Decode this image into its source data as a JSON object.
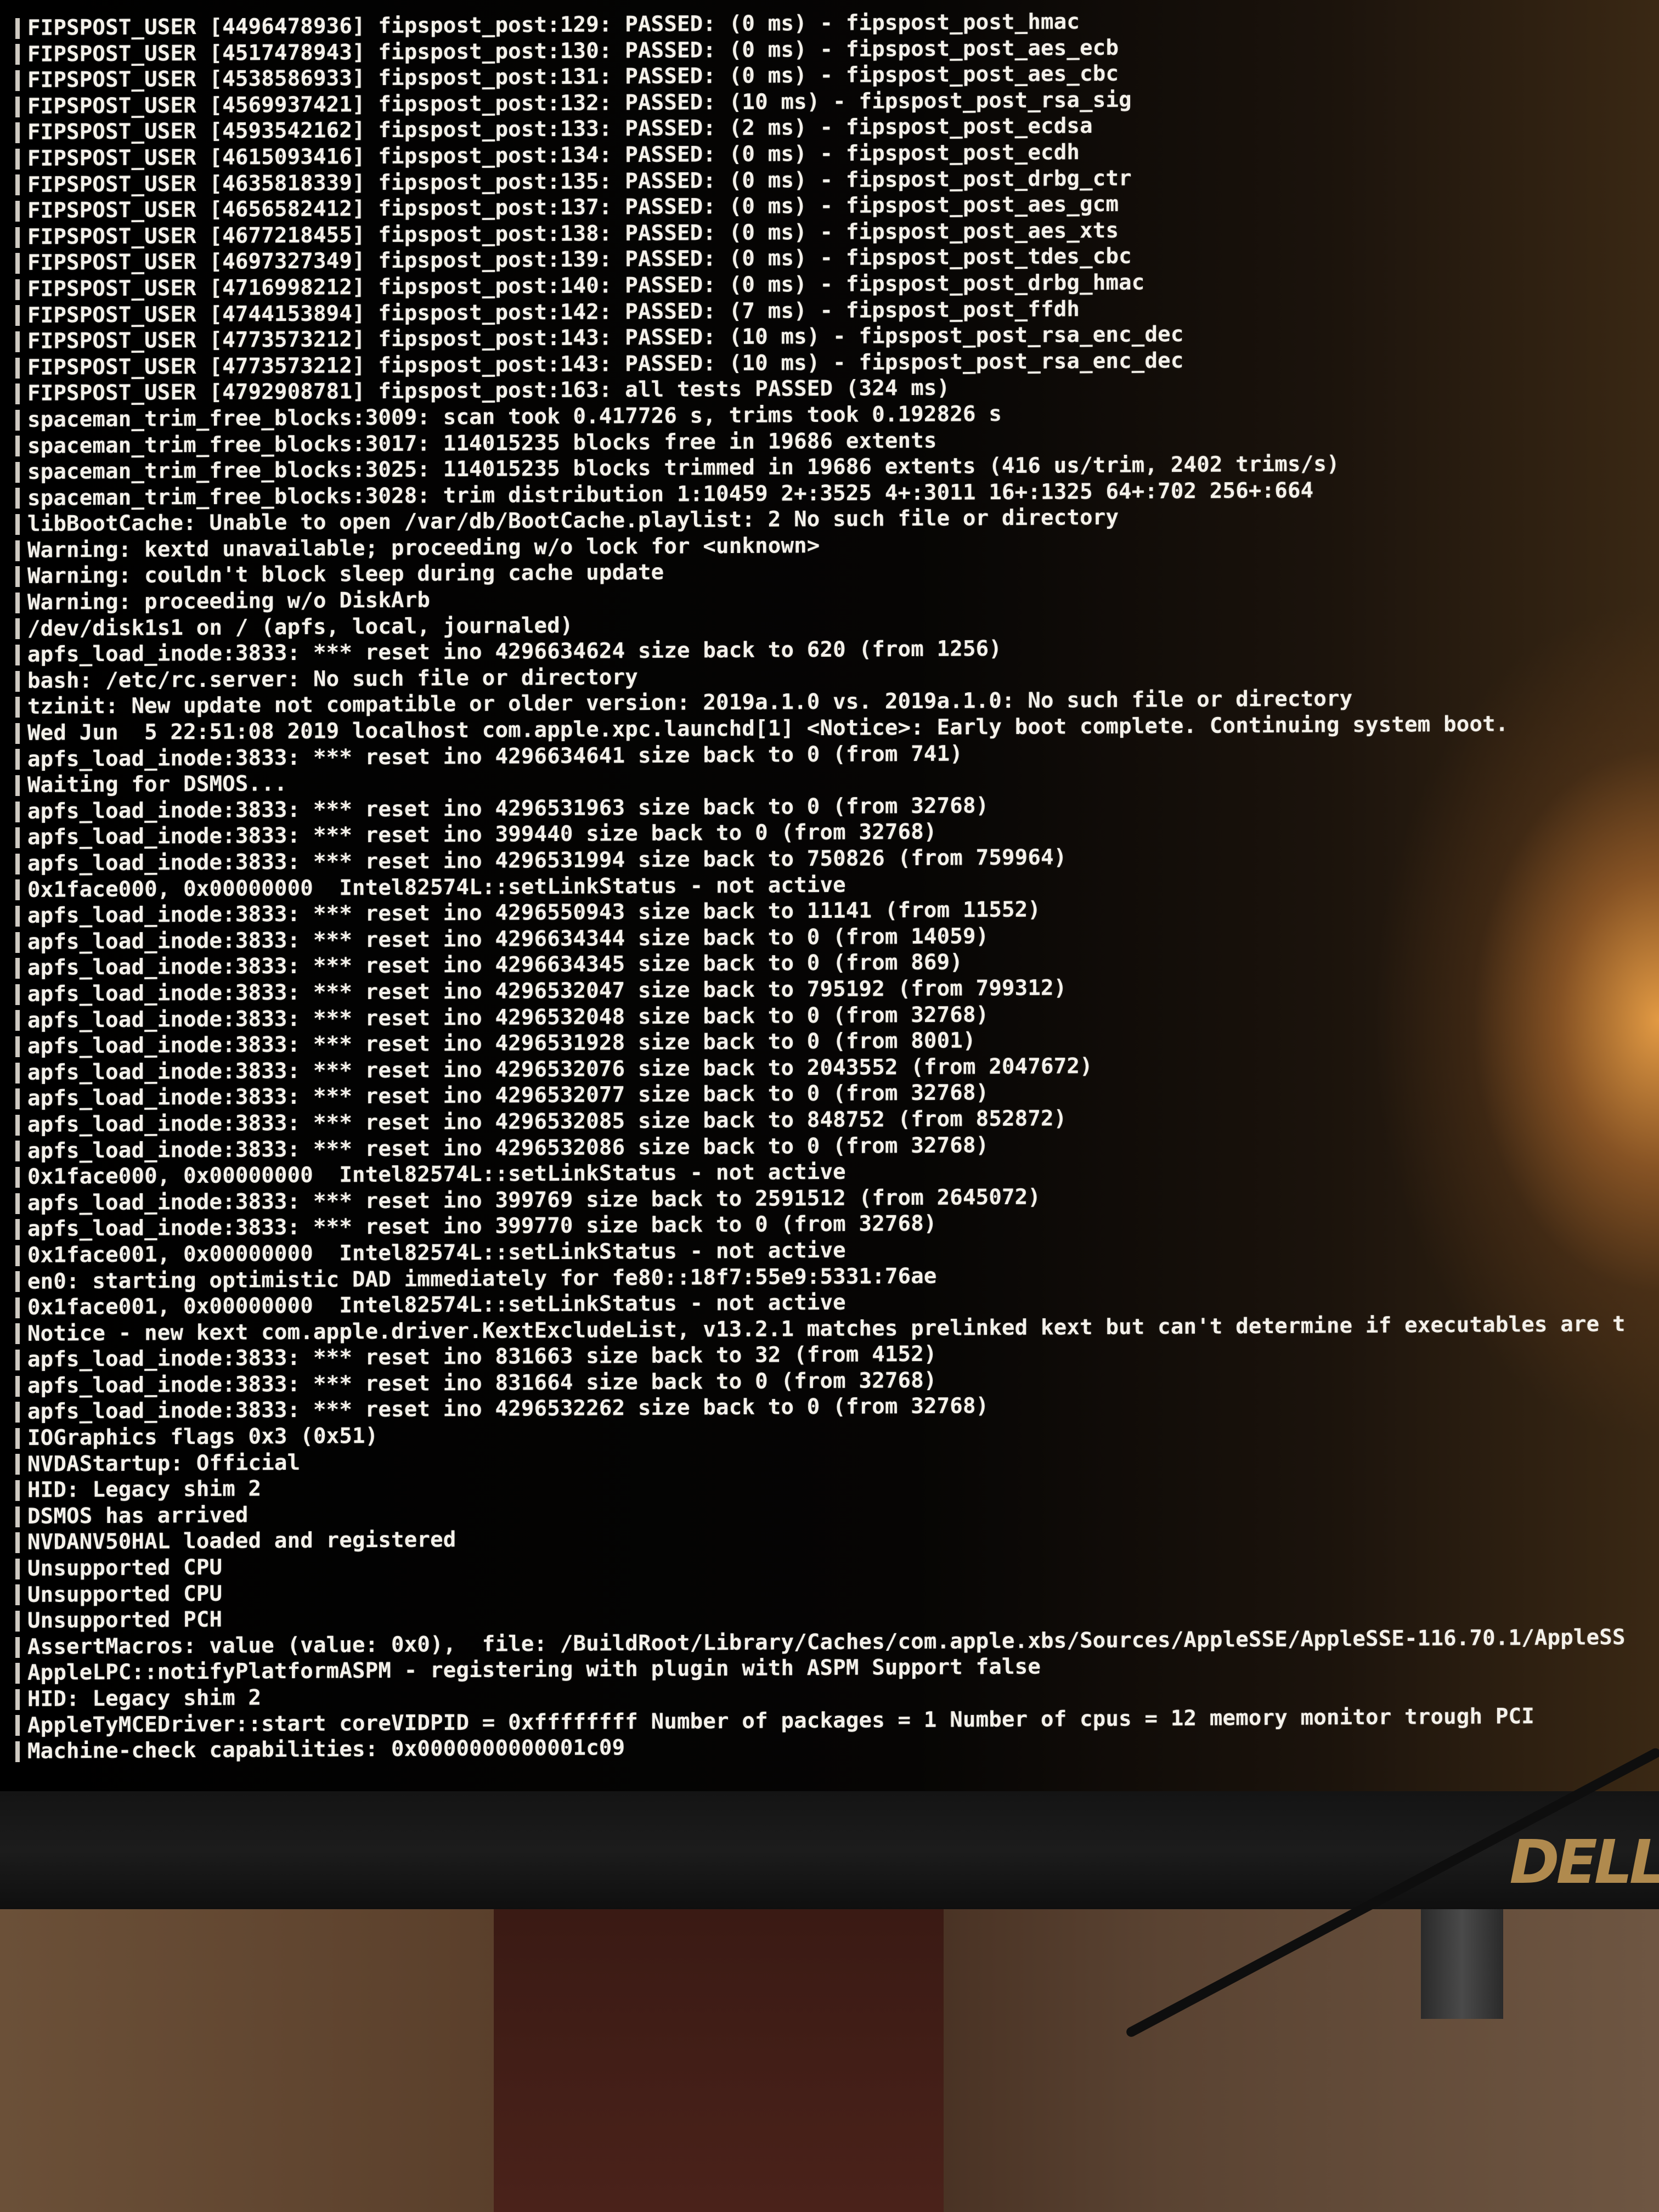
{
  "console": {
    "lines": [
      "FIPSPOST_USER [4496478936] fipspost_post:129: PASSED: (0 ms) - fipspost_post_hmac",
      "FIPSPOST_USER [4517478943] fipspost_post:130: PASSED: (0 ms) - fipspost_post_aes_ecb",
      "FIPSPOST_USER [4538586933] fipspost_post:131: PASSED: (0 ms) - fipspost_post_aes_cbc",
      "FIPSPOST_USER [4569937421] fipspost_post:132: PASSED: (10 ms) - fipspost_post_rsa_sig",
      "FIPSPOST_USER [4593542162] fipspost_post:133: PASSED: (2 ms) - fipspost_post_ecdsa",
      "FIPSPOST_USER [4615093416] fipspost_post:134: PASSED: (0 ms) - fipspost_post_ecdh",
      "FIPSPOST_USER [4635818339] fipspost_post:135: PASSED: (0 ms) - fipspost_post_drbg_ctr",
      "FIPSPOST_USER [4656582412] fipspost_post:137: PASSED: (0 ms) - fipspost_post_aes_gcm",
      "FIPSPOST_USER [4677218455] fipspost_post:138: PASSED: (0 ms) - fipspost_post_aes_xts",
      "FIPSPOST_USER [4697327349] fipspost_post:139: PASSED: (0 ms) - fipspost_post_tdes_cbc",
      "FIPSPOST_USER [4716998212] fipspost_post:140: PASSED: (0 ms) - fipspost_post_drbg_hmac",
      "FIPSPOST_USER [4744153894] fipspost_post:142: PASSED: (7 ms) - fipspost_post_ffdh",
      "FIPSPOST_USER [4773573212] fipspost_post:143: PASSED: (10 ms) - fipspost_post_rsa_enc_dec",
      "FIPSPOST_USER [4773573212] fipspost_post:143: PASSED: (10 ms) - fipspost_post_rsa_enc_dec",
      "FIPSPOST_USER [4792908781] fipspost_post:163: all tests PASSED (324 ms)",
      "spaceman_trim_free_blocks:3009: scan took 0.417726 s, trims took 0.192826 s",
      "spaceman_trim_free_blocks:3017: 114015235 blocks free in 19686 extents",
      "spaceman_trim_free_blocks:3025: 114015235 blocks trimmed in 19686 extents (416 us/trim, 2402 trims/s)",
      "spaceman_trim_free_blocks:3028: trim distribution 1:10459 2+:3525 4+:3011 16+:1325 64+:702 256+:664",
      "libBootCache: Unable to open /var/db/BootCache.playlist: 2 No such file or directory",
      "Warning: kextd unavailable; proceeding w/o lock for <unknown>",
      "Warning: couldn't block sleep during cache update",
      "Warning: proceeding w/o DiskArb",
      "/dev/disk1s1 on / (apfs, local, journaled)",
      "apfs_load_inode:3833: *** reset ino 4296634624 size back to 620 (from 1256)",
      "bash: /etc/rc.server: No such file or directory",
      "tzinit: New update not compatible or older version: 2019a.1.0 vs. 2019a.1.0: No such file or directory",
      "Wed Jun  5 22:51:08 2019 localhost com.apple.xpc.launchd[1] <Notice>: Early boot complete. Continuing system boot.",
      "apfs_load_inode:3833: *** reset ino 4296634641 size back to 0 (from 741)",
      "Waiting for DSMOS...",
      "apfs_load_inode:3833: *** reset ino 4296531963 size back to 0 (from 32768)",
      "apfs_load_inode:3833: *** reset ino 399440 size back to 0 (from 32768)",
      "apfs_load_inode:3833: *** reset ino 4296531994 size back to 750826 (from 759964)",
      "0x1face000, 0x00000000  Intel82574L::setLinkStatus - not active",
      "apfs_load_inode:3833: *** reset ino 4296550943 size back to 11141 (from 11552)",
      "apfs_load_inode:3833: *** reset ino 4296634344 size back to 0 (from 14059)",
      "apfs_load_inode:3833: *** reset ino 4296634345 size back to 0 (from 869)",
      "apfs_load_inode:3833: *** reset ino 4296532047 size back to 795192 (from 799312)",
      "apfs_load_inode:3833: *** reset ino 4296532048 size back to 0 (from 32768)",
      "apfs_load_inode:3833: *** reset ino 4296531928 size back to 0 (from 8001)",
      "apfs_load_inode:3833: *** reset ino 4296532076 size back to 2043552 (from 2047672)",
      "apfs_load_inode:3833: *** reset ino 4296532077 size back to 0 (from 32768)",
      "apfs_load_inode:3833: *** reset ino 4296532085 size back to 848752 (from 852872)",
      "apfs_load_inode:3833: *** reset ino 4296532086 size back to 0 (from 32768)",
      "0x1face000, 0x00000000  Intel82574L::setLinkStatus - not active",
      "apfs_load_inode:3833: *** reset ino 399769 size back to 2591512 (from 2645072)",
      "apfs_load_inode:3833: *** reset ino 399770 size back to 0 (from 32768)",
      "0x1face001, 0x00000000  Intel82574L::setLinkStatus - not active",
      "en0: starting optimistic DAD immediately for fe80::18f7:55e9:5331:76ae",
      "0x1face001, 0x00000000  Intel82574L::setLinkStatus - not active",
      "Notice - new kext com.apple.driver.KextExcludeList, v13.2.1 matches prelinked kext but can't determine if executables are t",
      "apfs_load_inode:3833: *** reset ino 831663 size back to 32 (from 4152)",
      "apfs_load_inode:3833: *** reset ino 831664 size back to 0 (from 32768)",
      "apfs_load_inode:3833: *** reset ino 4296532262 size back to 0 (from 32768)",
      "IOGraphics flags 0x3 (0x51)",
      "NVDAStartup: Official",
      "HID: Legacy shim 2",
      "DSMOS has arrived",
      "NVDANV50HAL loaded and registered",
      "Unsupported CPU",
      "Unsupported CPU",
      "Unsupported PCH",
      "AssertMacros: value (value: 0x0),  file: /BuildRoot/Library/Caches/com.apple.xbs/Sources/AppleSSE/AppleSSE-116.70.1/AppleSS",
      "AppleLPC::notifyPlatformASPM - registering with plugin with ASPM Support false",
      "HID: Legacy shim 2",
      "AppleTyMCEDriver::start coreVIDPID = 0xffffffff Number of packages = 1 Number of cpus = 12 memory monitor trough PCI",
      "Machine-check capabilities: 0x0000000000001c09"
    ]
  },
  "monitor": {
    "brand_logo": "DELL"
  },
  "colors": {
    "text": "#f4f1ea",
    "screen_bg": "#000000",
    "glare": "#eba046",
    "logo": "#b08a4e"
  }
}
